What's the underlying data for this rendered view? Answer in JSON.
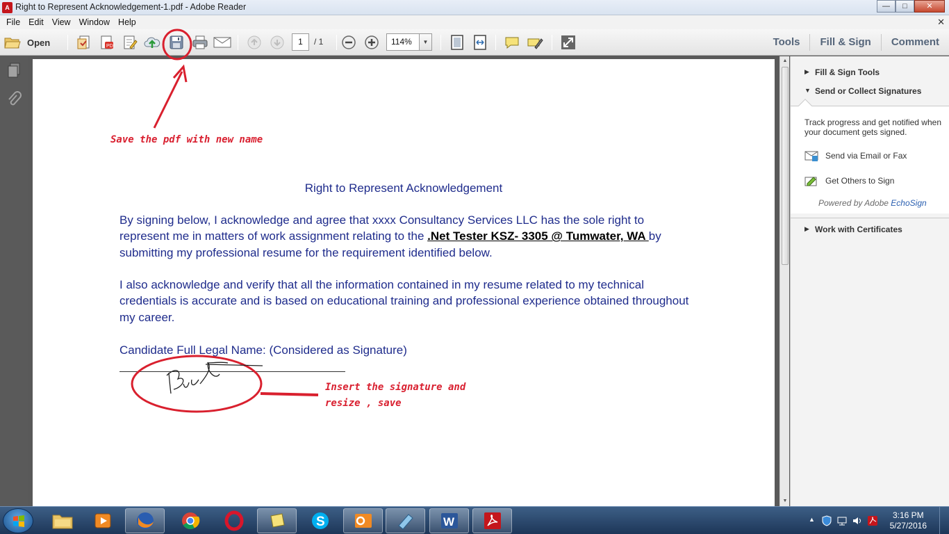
{
  "window": {
    "title": "Right to Represent Acknowledgement-1.pdf - Adobe Reader",
    "min": "—",
    "max": "□",
    "close": "✕"
  },
  "menu": {
    "items": [
      "File",
      "Edit",
      "View",
      "Window",
      "Help"
    ],
    "close": "✕"
  },
  "toolbar": {
    "open_label": "Open",
    "page_current": "1",
    "page_total": "/ 1",
    "zoom": "114%",
    "tabs": [
      "Tools",
      "Fill & Sign",
      "Comment"
    ]
  },
  "document": {
    "title": "Right to Represent Acknowledgement",
    "para1_start": "By signing below, I acknowledge and agree that xxxx Consultancy Services LLC has the sole right to represent me in matters of work assignment relating to the ",
    "para1_bold": ".Net Tester KSZ- 3305 @ Tumwater, WA ",
    "para1_end": "by submitting my professional resume for the requirement identified below.",
    "para2": "I also acknowledge and verify that all the information contained in my resume related to my technical credentials is accurate and is based on educational training and professional experience obtained throughout my career.",
    "name_label": "Candidate Full Legal Name: (Considered as Signature)"
  },
  "annotations": {
    "save_note": "Save the pdf with new name",
    "sig_note_line1": "Insert the signature and",
    "sig_note_line2": "resize , save"
  },
  "colors": {
    "doc_text": "#1f2c8c",
    "annotation": "#d92030"
  },
  "right_pane": {
    "fill_sign_tools": "Fill & Sign Tools",
    "send_collect": "Send or Collect Signatures",
    "track_text": "Track progress and get notified when your document gets signed.",
    "send_email": "Send via Email or Fax",
    "get_others": "Get Others to Sign",
    "powered_by": "Powered by Adobe ",
    "powered_brand": "EchoSign",
    "certificates": "Work with Certificates"
  },
  "taskbar": {
    "time": "3:16 PM",
    "date": "5/27/2016",
    "apps": [
      "explorer-icon",
      "media-player-icon",
      "firefox-icon",
      "chrome-icon",
      "opera-icon",
      "sticky-notes-icon",
      "skype-icon",
      "outlook-icon",
      "paint-icon",
      "word-icon",
      "adobe-reader-icon"
    ]
  }
}
